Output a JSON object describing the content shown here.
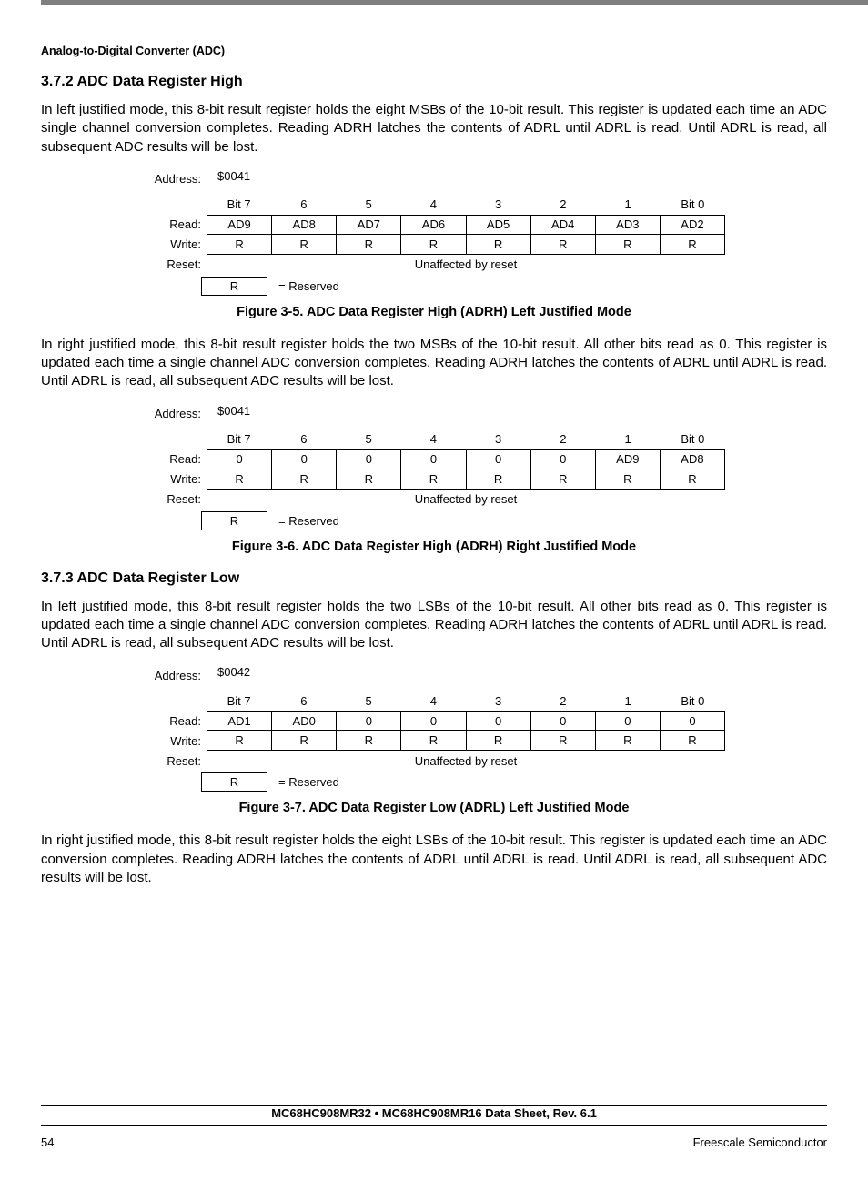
{
  "header": {
    "section_label": "Analog-to-Digital Converter (ADC)"
  },
  "sec372": {
    "heading": "3.7.2  ADC Data Register High",
    "para1": "In left justified mode, this 8-bit result register holds the eight MSBs of the 10-bit result. This register is updated each time an ADC single channel conversion completes. Reading ADRH latches the contents of ADRL until ADRL is read. Until ADRL is read, all subsequent ADC results will be lost.",
    "para2": "In right justified mode, this 8-bit result register holds the two MSBs of the 10-bit result. All other bits read as 0. This register is updated each time a single channel ADC conversion completes. Reading ADRH latches the contents of ADRL until ADRL is read. Until ADRL is read, all subsequent ADC results will be lost."
  },
  "sec373": {
    "heading": "3.7.3  ADC Data Register Low",
    "para1": "In left justified mode, this 8-bit result register holds the two LSBs of the 10-bit result. All other bits read as 0. This register is updated each time a single channel ADC conversion completes. Reading ADRH latches the contents of ADRL until ADRL is read. Until ADRL is read, all subsequent ADC results will be lost.",
    "para2": "In right justified mode, this 8-bit result register holds the eight LSBs of the 10-bit result. This register is updated each time an ADC conversion completes. Reading ADRH latches the contents of ADRL until ADRL is read. Until ADRL is read, all subsequent ADC results will be lost."
  },
  "labels": {
    "address": "Address:",
    "read": "Read:",
    "write": "Write:",
    "reset": "Reset:",
    "reserved_key": "R",
    "reserved_val": "= Reserved",
    "unaffected": "Unaffected by reset"
  },
  "bits": [
    "Bit 7",
    "6",
    "5",
    "4",
    "3",
    "2",
    "1",
    "Bit 0"
  ],
  "fig35": {
    "addr": "$0041",
    "read": [
      "AD9",
      "AD8",
      "AD7",
      "AD6",
      "AD5",
      "AD4",
      "AD3",
      "AD2"
    ],
    "write": [
      "R",
      "R",
      "R",
      "R",
      "R",
      "R",
      "R",
      "R"
    ],
    "caption": "Figure 3-5. ADC Data Register High (ADRH) Left Justified Mode"
  },
  "fig36": {
    "addr": "$0041",
    "read": [
      "0",
      "0",
      "0",
      "0",
      "0",
      "0",
      "AD9",
      "AD8"
    ],
    "write": [
      "R",
      "R",
      "R",
      "R",
      "R",
      "R",
      "R",
      "R"
    ],
    "caption": "Figure 3-6. ADC Data Register High (ADRH) Right Justified Mode"
  },
  "fig37": {
    "addr": "$0042",
    "read": [
      "AD1",
      "AD0",
      "0",
      "0",
      "0",
      "0",
      "0",
      "0"
    ],
    "write": [
      "R",
      "R",
      "R",
      "R",
      "R",
      "R",
      "R",
      "R"
    ],
    "caption": "Figure 3-7. ADC Data Register Low (ADRL) Left Justified Mode"
  },
  "footer": {
    "doc": "MC68HC908MR32 • MC68HC908MR16 Data Sheet, Rev. 6.1",
    "page": "54",
    "company": "Freescale Semiconductor"
  }
}
